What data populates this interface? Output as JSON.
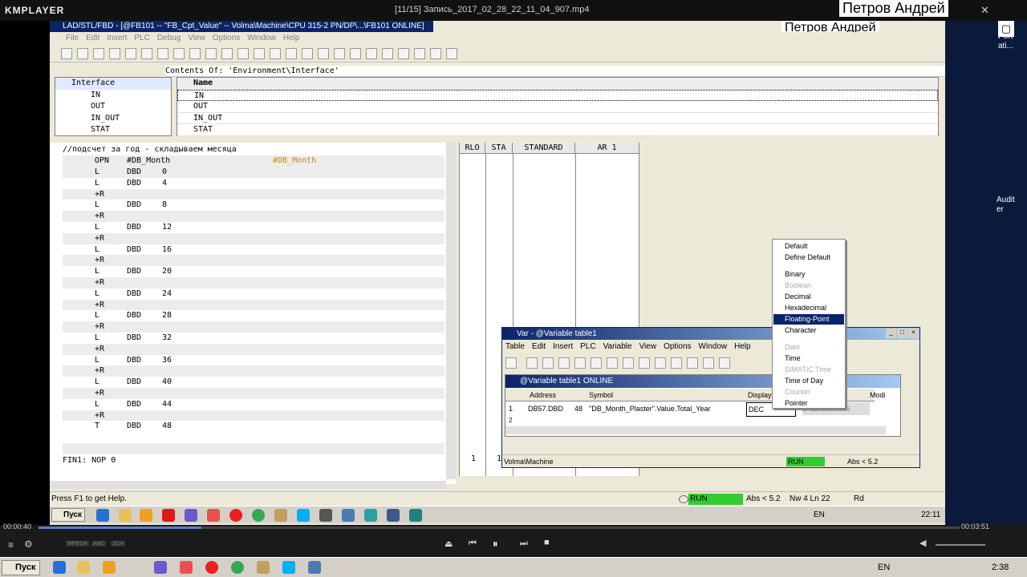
{
  "player": {
    "logo": "KMPLAYER",
    "file_title": "[11/15] Запись_2017_02_28_22_11_04_907.mp4",
    "time_elapsed": "00:00:40",
    "time_total": "00:03:51",
    "progress_fraction": 0.177,
    "format_badges": [
      "MPEG4",
      "AAC",
      "2CH"
    ],
    "close_glyph": "✕"
  },
  "watermark": {
    "top": "Петров Андрей",
    "inner": "Петров Андрей"
  },
  "s7": {
    "title": "LAD/STL/FBD - [@FB101 -- \"FB_Cpt_Value\" -- Volma\\Machine\\CPU 315-2 PN/DP\\...\\FB101  ONLINE]",
    "menu": [
      "File",
      "Edit",
      "Insert",
      "PLC",
      "Debug",
      "View",
      "Options",
      "Window",
      "Help"
    ],
    "contents_of": "Contents Of: 'Environment\\Interface'",
    "tree": [
      "Interface",
      "IN",
      "OUT",
      "IN_OUT",
      "STAT"
    ],
    "grid_header": "Name",
    "grid_rows": [
      "IN",
      "OUT",
      "IN_OUT",
      "STAT"
    ],
    "comment": "//подсчет за год - складываем месяца",
    "stl_header": {
      "op": "OPN",
      "operand": "#DB_Month",
      "extra": "#DB_Month"
    },
    "stl_lines": [
      {
        "op": "L",
        "operand": "DBD",
        "num": "0"
      },
      {
        "op": "L",
        "operand": "DBD",
        "num": "4"
      },
      {
        "op": "+R",
        "operand": "",
        "num": ""
      },
      {
        "op": "L",
        "operand": "DBD",
        "num": "8"
      },
      {
        "op": "+R",
        "operand": "",
        "num": ""
      },
      {
        "op": "L",
        "operand": "DBD",
        "num": "12"
      },
      {
        "op": "+R",
        "operand": "",
        "num": ""
      },
      {
        "op": "L",
        "operand": "DBD",
        "num": "16"
      },
      {
        "op": "+R",
        "operand": "",
        "num": ""
      },
      {
        "op": "L",
        "operand": "DBD",
        "num": "20"
      },
      {
        "op": "+R",
        "operand": "",
        "num": ""
      },
      {
        "op": "L",
        "operand": "DBD",
        "num": "24"
      },
      {
        "op": "+R",
        "operand": "",
        "num": ""
      },
      {
        "op": "L",
        "operand": "DBD",
        "num": "28"
      },
      {
        "op": "+R",
        "operand": "",
        "num": ""
      },
      {
        "op": "L",
        "operand": "DBD",
        "num": "32"
      },
      {
        "op": "+R",
        "operand": "",
        "num": ""
      },
      {
        "op": "L",
        "operand": "DBD",
        "num": "36"
      },
      {
        "op": "+R",
        "operand": "",
        "num": ""
      },
      {
        "op": "L",
        "operand": "DBD",
        "num": "40"
      },
      {
        "op": "+R",
        "operand": "",
        "num": ""
      },
      {
        "op": "L",
        "operand": "DBD",
        "num": "44"
      },
      {
        "op": "+R",
        "operand": "",
        "num": ""
      },
      {
        "op": "T",
        "operand": "DBD",
        "num": "48"
      }
    ],
    "fin_line": "FIN1: NOP    0",
    "status_headers": [
      "RLO",
      "STA",
      "STANDARD",
      "AR 1"
    ],
    "status_footer": [
      "1",
      "1"
    ],
    "status": {
      "help": "Press F1 to get Help.",
      "run": "RUN",
      "abs": "Abs < 5.2",
      "pos": "Nw 4  Ln 22",
      "mode": "Rd"
    },
    "taskbar": {
      "start": "Пуск",
      "lang": "EN",
      "clock": "22:11"
    }
  },
  "var_window": {
    "title": "Var - @Variable table1",
    "menu": [
      "Table",
      "Edit",
      "Insert",
      "PLC",
      "Variable",
      "View",
      "Options",
      "Window",
      "Help"
    ],
    "inner_title": "@Variable table1  ONLINE",
    "columns": [
      "Address",
      "Symbol",
      "Display",
      "Modi"
    ],
    "rows": [
      {
        "num": "1",
        "address": "DB57.DBD",
        "len": "48",
        "symbol": "\"DB_Month_Plaster\".Value.Total_Year",
        "display": "DEC",
        "value": "L#1191695656"
      }
    ],
    "row2_num": "2",
    "status": {
      "path": "Volma\\Machine",
      "run": "RUN",
      "abs": "Abs < 5.2"
    }
  },
  "context_menu": [
    {
      "label": "Default",
      "disabled": false,
      "selected": false
    },
    {
      "label": "Define Default",
      "disabled": false,
      "selected": false
    },
    {
      "label": "Binary",
      "disabled": false,
      "selected": false
    },
    {
      "label": "Boolean",
      "disabled": true,
      "selected": false
    },
    {
      "label": "Decimal",
      "disabled": false,
      "selected": false
    },
    {
      "label": "Hexadecimal",
      "disabled": false,
      "selected": false
    },
    {
      "label": "Floating-Point",
      "disabled": false,
      "selected": true
    },
    {
      "label": "Character",
      "disabled": false,
      "selected": false
    },
    {
      "label": "Date",
      "disabled": true,
      "selected": false
    },
    {
      "label": "Time",
      "disabled": false,
      "selected": false
    },
    {
      "label": "SIMATIC Time",
      "disabled": true,
      "selected": false
    },
    {
      "label": "Time of Day",
      "disabled": false,
      "selected": false
    },
    {
      "label": "Counter",
      "disabled": true,
      "selected": false
    },
    {
      "label": "Pointer",
      "disabled": false,
      "selected": false
    }
  ],
  "right_strip": {
    "text1": "Port",
    "text2": "ati...",
    "text3": "Audit",
    "text4": "er"
  },
  "host_taskbar": {
    "start": "Пуск",
    "lang": "EN",
    "clock": "2:38"
  },
  "colors": {
    "run_green": "#33cc33",
    "title_blue": "#0a246a",
    "progress": "#5b7fc8"
  }
}
